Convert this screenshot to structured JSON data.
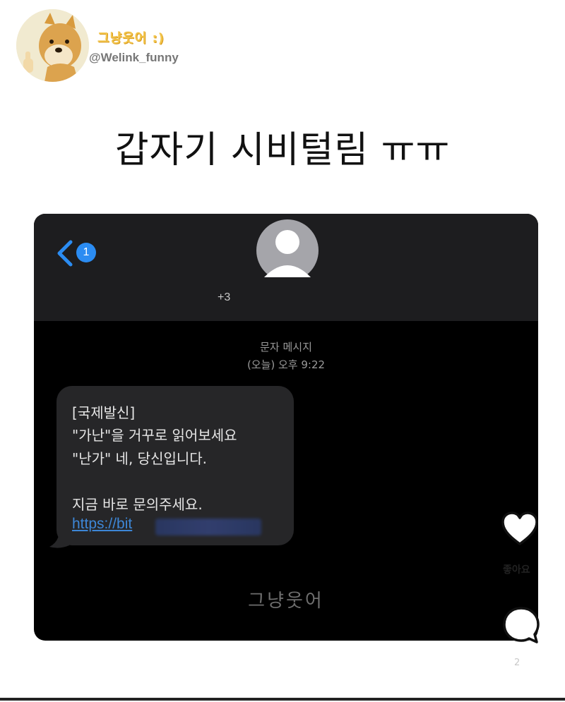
{
  "account": {
    "name": "그냥웃어 :)",
    "handle": "@Welink_funny",
    "avatar_icon": "shiba-dog-avatar"
  },
  "post": {
    "headline": "갑자기 시비털림 ㅠㅠ"
  },
  "screenshot": {
    "back_icon": "chevron-left-icon",
    "unread_count": "1",
    "contact_icon": "person-icon",
    "contact_number": "+3",
    "message_type": "문자 메시지",
    "message_time": "(오늘) 오후 9:22",
    "message_lines": [
      "[국제발신]",
      "\"가난\"을 거꾸로 읽어보세요",
      "\"난가\" 네, 당신입니다.",
      "",
      "지금 바로 문의주세요."
    ],
    "message_link": "https://bit",
    "watermark": "그냥웃어"
  },
  "actions": {
    "like_icon": "heart-icon",
    "like_label": "좋아요",
    "comment_icon": "comment-icon",
    "comment_count": "2"
  },
  "colors": {
    "accent_blue": "#2b8cf2",
    "bubble_gray": "#262628",
    "link_blue": "#3d86d6"
  }
}
